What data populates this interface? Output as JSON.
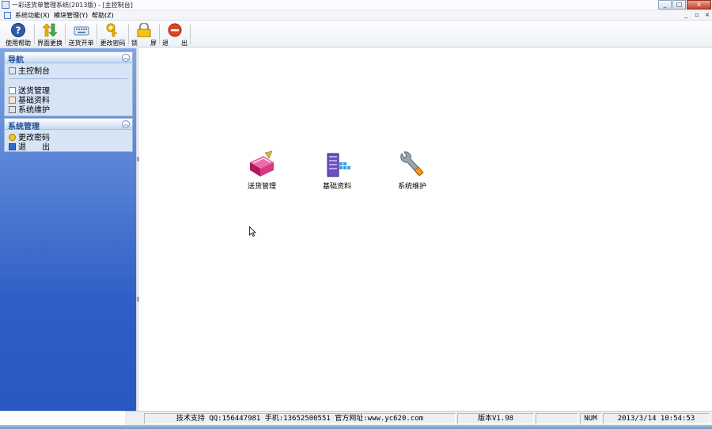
{
  "window": {
    "title": "一彩送货单管理系统(2013版) - [主控制台]",
    "controls": [
      "_",
      "□",
      "×"
    ],
    "mdi_controls": [
      "_",
      "▫",
      "×"
    ]
  },
  "menubar": {
    "items": [
      "系统功能(X)",
      "模块管理(Y)",
      "帮助(Z)"
    ]
  },
  "toolbar": {
    "buttons": [
      {
        "label": "使用帮助",
        "icon": "help-icon"
      },
      {
        "label": "界面更换",
        "icon": "skin-switch-icon"
      },
      {
        "label": "送货开单",
        "icon": "keyboard-icon"
      },
      {
        "label": "更改密码",
        "icon": "key-icon"
      },
      {
        "label": "锁　　屏",
        "icon": "lock-icon"
      },
      {
        "label": "退　　出",
        "icon": "exit-icon"
      }
    ]
  },
  "sidebar": {
    "nav": {
      "title": "导航",
      "collapse": "︽",
      "items": [
        "主控制台",
        "送货管理",
        "基础资料",
        "系统维护"
      ]
    },
    "system": {
      "title": "系统管理",
      "collapse": "︽",
      "items": [
        "更改密码",
        "退　　出"
      ]
    }
  },
  "main": {
    "modules": [
      {
        "label": "送货管理",
        "icon": "delivery-book-icon"
      },
      {
        "label": "基础资料",
        "icon": "database-server-icon"
      },
      {
        "label": "系统维护",
        "icon": "wrench-icon"
      }
    ]
  },
  "statusbar": {
    "support": "技术支持 QQ:156447981 手机:13652500551 官方网址:www.yc620.com",
    "version": "版本V1.98",
    "numlock": "NUM",
    "datetime": "2013/3/14 10:54:53"
  },
  "colors": {
    "sidebar_top": "#7ea4e3",
    "sidebar_bottom": "#2a58c2",
    "panel_bg": "#d6e4f5",
    "panel_title": "#1e4f9a"
  }
}
